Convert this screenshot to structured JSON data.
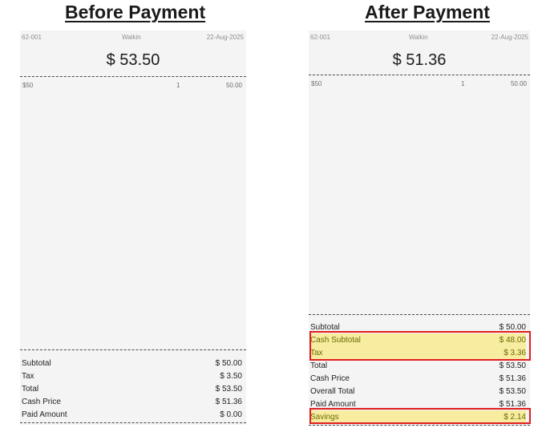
{
  "before": {
    "heading": "Before Payment",
    "order_id": "62-001",
    "customer": "Walkin",
    "date": "22-Aug-2025",
    "total_display": "$ 53.50",
    "item": {
      "name": "$50",
      "qty": "1",
      "price": "50.00"
    },
    "summary": [
      {
        "label": "Subtotal",
        "value": "$ 50.00"
      },
      {
        "label": "Tax",
        "value": "$ 3.50"
      },
      {
        "label": "Total",
        "value": "$ 53.50"
      },
      {
        "label": "Cash Price",
        "value": "$ 51.36"
      },
      {
        "label": "Paid Amount",
        "value": "$ 0.00"
      }
    ]
  },
  "after": {
    "heading": "After Payment",
    "order_id": "62-001",
    "customer": "Walkin",
    "date": "22-Aug-2025",
    "total_display": "$ 51.36",
    "item": {
      "name": "$50",
      "qty": "1",
      "price": "50.00"
    },
    "summary": [
      {
        "label": "Subtotal",
        "value": "$ 50.00"
      },
      {
        "label": "Cash Subtotal",
        "value": "$ 48.00"
      },
      {
        "label": "Tax",
        "value": "$ 3.36"
      },
      {
        "label": "Total",
        "value": "$ 53.50"
      },
      {
        "label": "Cash Price",
        "value": "$ 51.36"
      },
      {
        "label": "Overall Total",
        "value": "$ 53.50"
      },
      {
        "label": "Paid Amount",
        "value": "$ 51.36"
      },
      {
        "label": "Savings",
        "value": "$ 2.14"
      }
    ]
  },
  "colors": {
    "highlight_fill": "#f7eca0",
    "highlight_border": "#e02020",
    "receipt_background": "#f4f4f4"
  }
}
